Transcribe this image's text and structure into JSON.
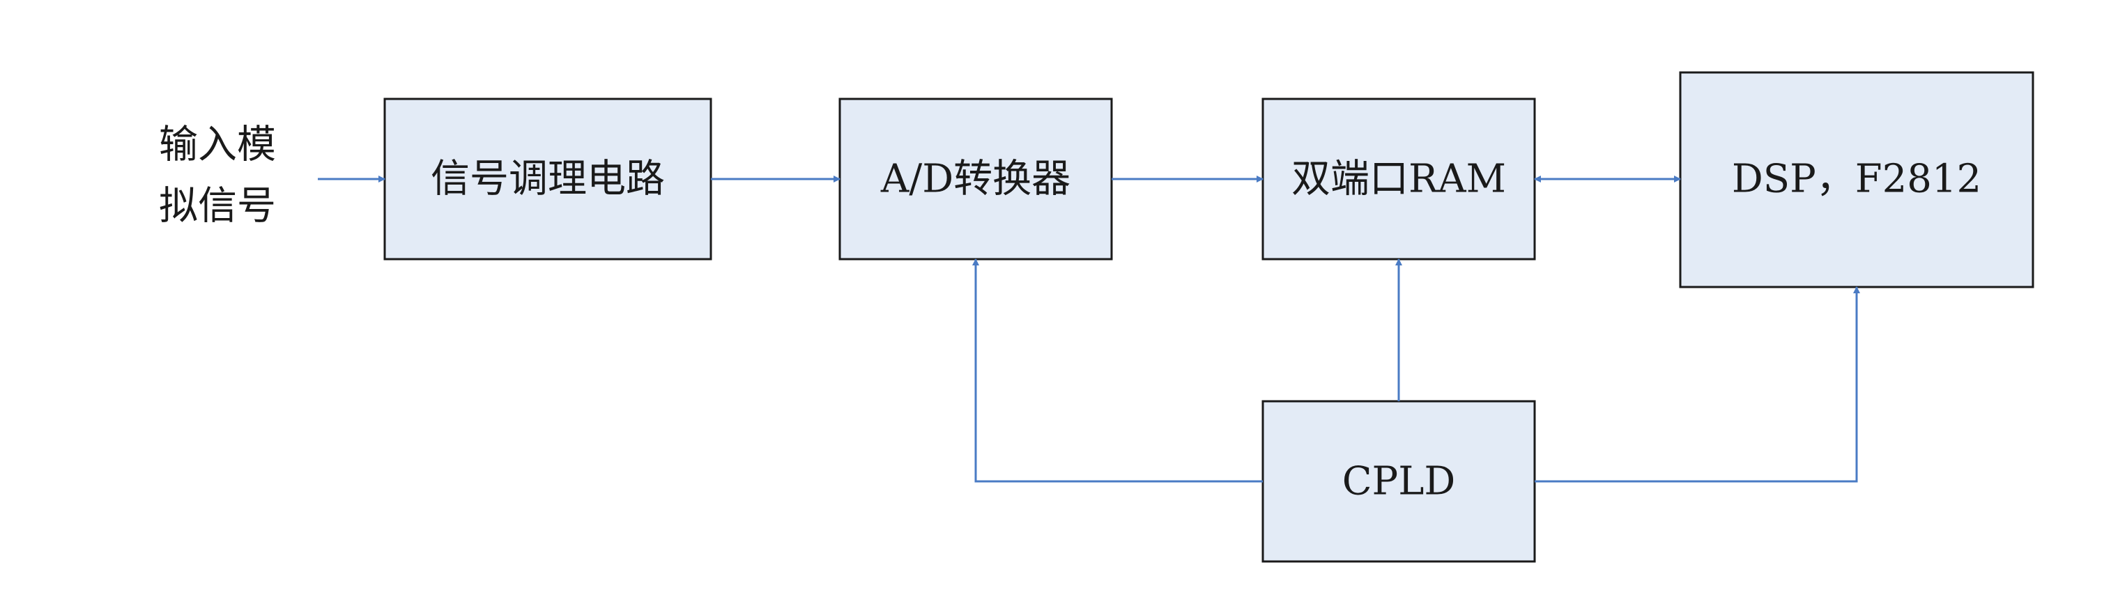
{
  "diagram": {
    "input_label": {
      "line1": "输入模",
      "line2": "拟信号"
    },
    "blocks": {
      "signal_conditioning": "信号调理电路",
      "ad_converter": "A/D转换器",
      "dual_port_ram": "双端口RAM",
      "dsp": "DSP，F2812",
      "cpld": "CPLD"
    },
    "colors": {
      "box_fill": "#e3ebf6",
      "box_stroke": "#1a1a1a",
      "arrow": "#4a7bc4",
      "text": "#1a1a1a"
    }
  }
}
